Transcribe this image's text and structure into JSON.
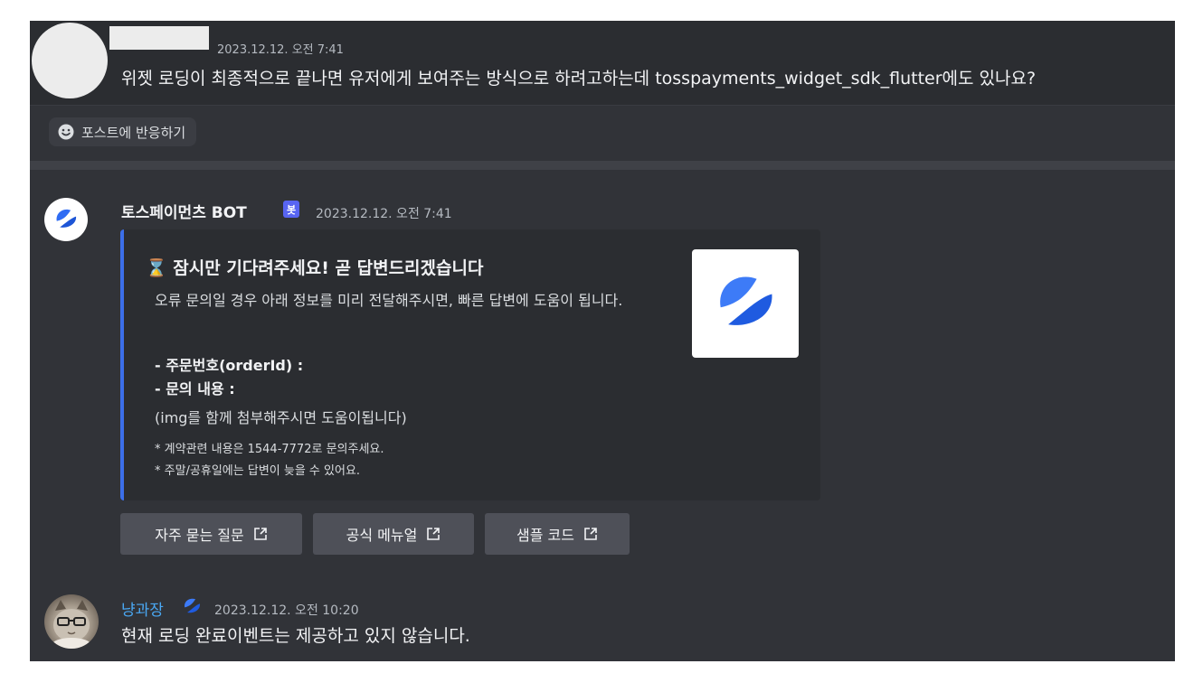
{
  "op": {
    "timestamp": "2023.12.12. 오전 7:41",
    "message": "위젯 로딩이 최종적으로 끝나면 유저에게 보여주는 방식으로 하려고하는데 tosspayments_widget_sdk_flutter에도 있나요?",
    "react_label": "포스트에 반응하기"
  },
  "bot": {
    "name": "토스페이먼츠 BOT",
    "badge": "봇",
    "timestamp": "2023.12.12. 오전 7:41",
    "embed": {
      "title_icon": "⌛",
      "title": "잠시만 기다려주세요! 곧 답변드리겠습니다",
      "description": "오류 문의일 경우 아래 정보를 미리 전달해주시면, 빠른 답변에 도움이 됩니다.",
      "field_order": "- 주문번호(orderId) :",
      "field_content": "- 문의 내용 :",
      "hint": "(img를 함께 첨부해주시면 도움이됩니다)",
      "note1": "* 계약관련 내용은 1544-7772로 문의주세요.",
      "note2": "* 주말/공휴일에는 답변이 늦을 수 있어요."
    },
    "buttons": [
      "자주 묻는 질문",
      "공식 메뉴얼",
      "샘플 코드"
    ]
  },
  "reply": {
    "name": "냥과장",
    "timestamp": "2023.12.12. 오전 10:20",
    "message": "현재 로딩 완료이벤트는 제공하고 있지 않습니다."
  },
  "colors": {
    "background": "#313338",
    "embed_accent": "#3c6fe9",
    "bot_badge": "#5865f2",
    "username_blue": "#4aa8f3",
    "toss_blue": "#2f6cf3"
  },
  "icons": {
    "react": "smile-icon",
    "external": "external-link-icon",
    "brand": "toss-logo-icon"
  }
}
